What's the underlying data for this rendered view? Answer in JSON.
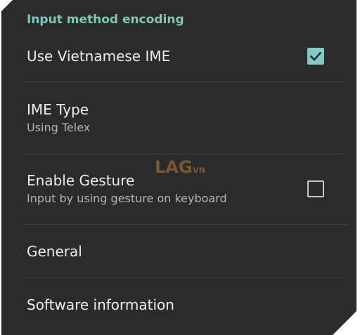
{
  "section_header": "Input method encoding",
  "prefs": {
    "use_vietnamese_ime": {
      "title": "Use Vietnamese IME",
      "checked": true
    },
    "ime_type": {
      "title": "IME Type",
      "summary": "Using Telex"
    },
    "enable_gesture": {
      "title": "Enable Gesture",
      "summary": "Input by using gesture on keyboard",
      "checked": false
    },
    "general": {
      "title": "General"
    },
    "software_information": {
      "title": "Software information"
    }
  },
  "watermark": {
    "logo_text": "LAG",
    "logo_suffix": ".VN"
  },
  "colors": {
    "background": "#2b2b2b",
    "accent": "#80cbc4",
    "header": "#7fc8bc",
    "title": "#ededed",
    "summary": "#b4b4b4"
  }
}
